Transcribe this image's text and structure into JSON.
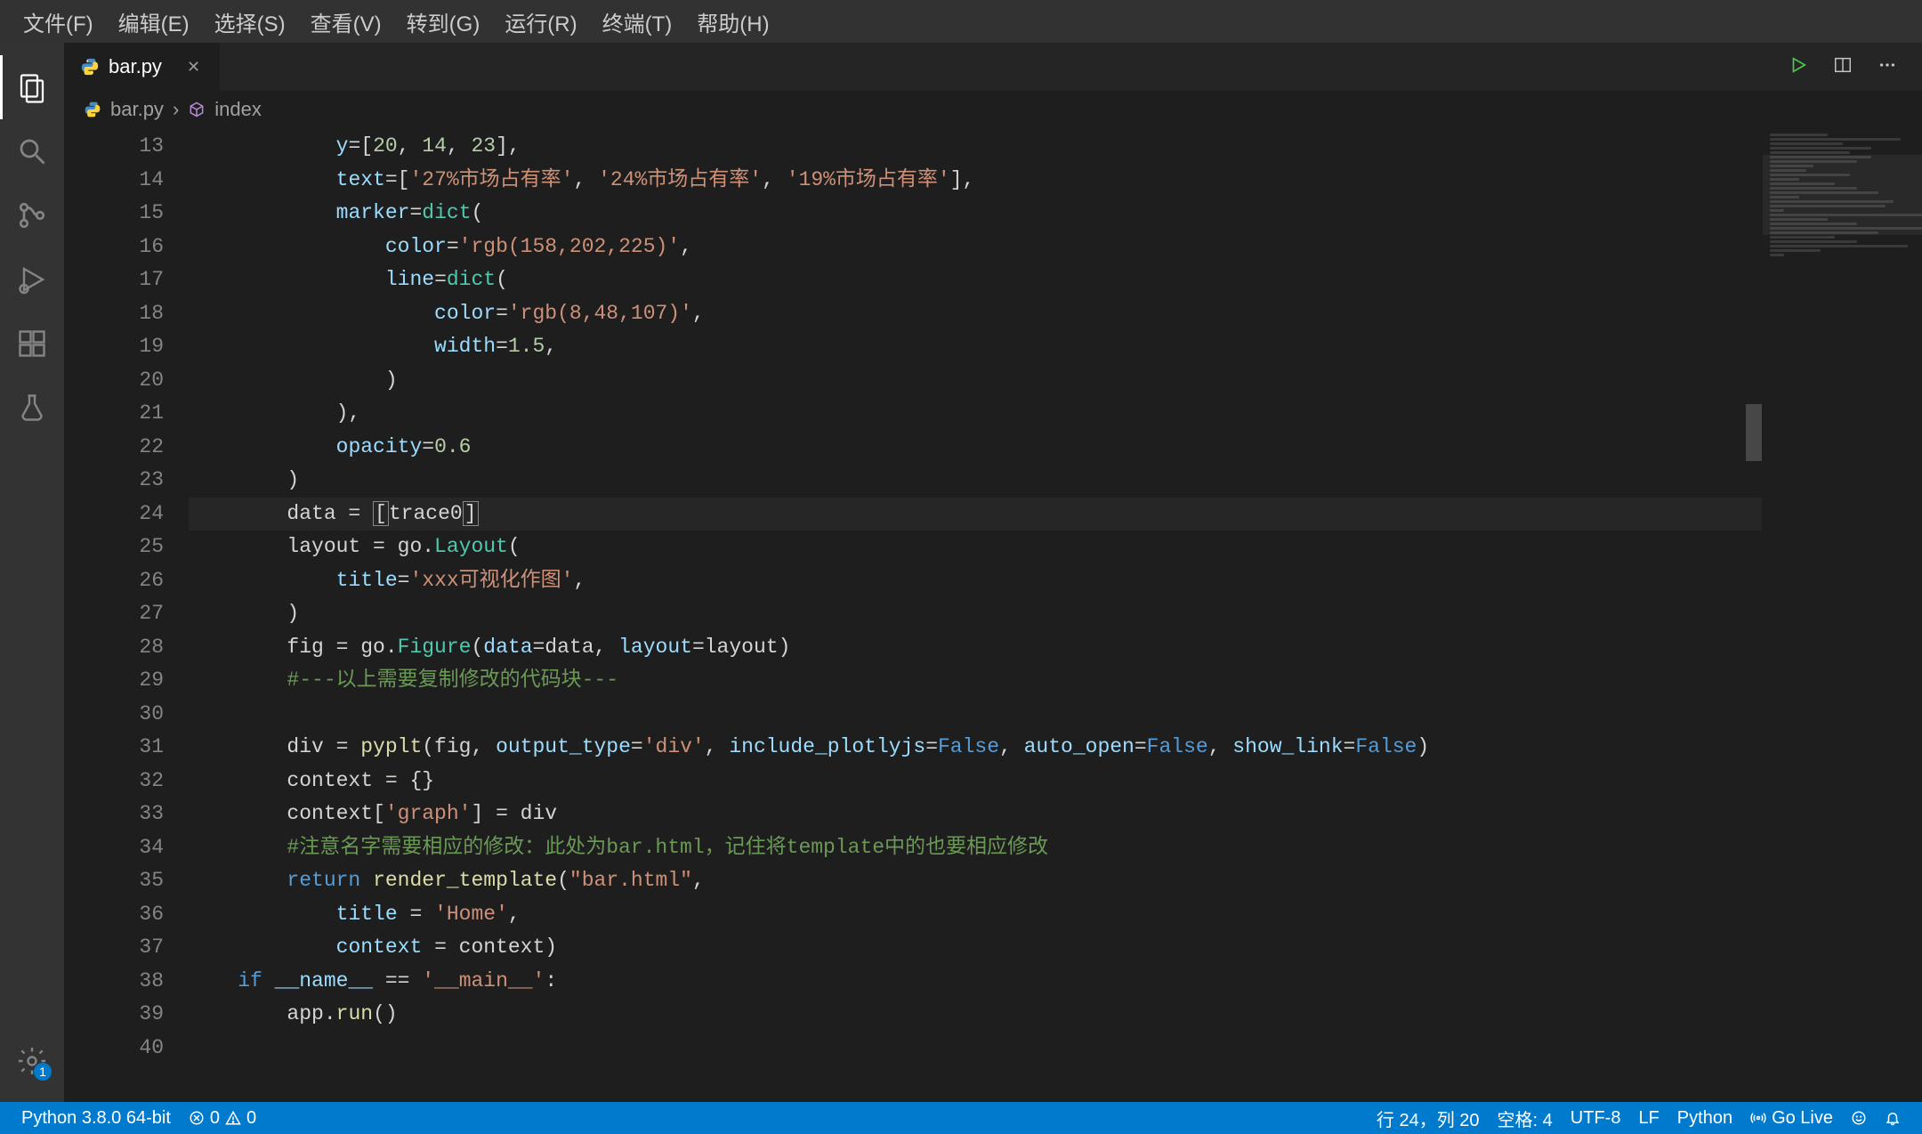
{
  "menubar": {
    "items": [
      "文件(F)",
      "编辑(E)",
      "选择(S)",
      "查看(V)",
      "转到(G)",
      "运行(R)",
      "终端(T)",
      "帮助(H)"
    ]
  },
  "activitybar": {
    "badge": "1"
  },
  "tab": {
    "filename": "bar.py"
  },
  "breadcrumbs": {
    "file": "bar.py",
    "symbol": "index"
  },
  "editor": {
    "first_line_no": 13,
    "lines": [
      {
        "n": 13,
        "tokens": [
          [
            "            ",
            "pun"
          ],
          [
            "y",
            "var"
          ],
          [
            "=[",
            "pun"
          ],
          [
            "20",
            "num"
          ],
          [
            ", ",
            "pun"
          ],
          [
            "14",
            "num"
          ],
          [
            ", ",
            "pun"
          ],
          [
            "23",
            "num"
          ],
          [
            "],",
            "pun"
          ]
        ]
      },
      {
        "n": 14,
        "tokens": [
          [
            "            ",
            "pun"
          ],
          [
            "text",
            "var"
          ],
          [
            "=[",
            "pun"
          ],
          [
            "'27%市场占有率'",
            "str"
          ],
          [
            ", ",
            "pun"
          ],
          [
            "'24%市场占有率'",
            "str"
          ],
          [
            ", ",
            "pun"
          ],
          [
            "'19%市场占有率'",
            "str"
          ],
          [
            "],",
            "pun"
          ]
        ]
      },
      {
        "n": 15,
        "tokens": [
          [
            "            ",
            "pun"
          ],
          [
            "marker",
            "var"
          ],
          [
            "=",
            "pun"
          ],
          [
            "dict",
            "type"
          ],
          [
            "(",
            "pun"
          ]
        ]
      },
      {
        "n": 16,
        "tokens": [
          [
            "                ",
            "pun"
          ],
          [
            "color",
            "var"
          ],
          [
            "=",
            "pun"
          ],
          [
            "'rgb(158,202,225)'",
            "str"
          ],
          [
            ",",
            "pun"
          ]
        ]
      },
      {
        "n": 17,
        "tokens": [
          [
            "                ",
            "pun"
          ],
          [
            "line",
            "var"
          ],
          [
            "=",
            "pun"
          ],
          [
            "dict",
            "type"
          ],
          [
            "(",
            "pun"
          ]
        ]
      },
      {
        "n": 18,
        "tokens": [
          [
            "                    ",
            "pun"
          ],
          [
            "color",
            "var"
          ],
          [
            "=",
            "pun"
          ],
          [
            "'rgb(8,48,107)'",
            "str"
          ],
          [
            ",",
            "pun"
          ]
        ]
      },
      {
        "n": 19,
        "tokens": [
          [
            "                    ",
            "pun"
          ],
          [
            "width",
            "var"
          ],
          [
            "=",
            "pun"
          ],
          [
            "1.5",
            "num"
          ],
          [
            ",",
            "pun"
          ]
        ]
      },
      {
        "n": 20,
        "tokens": [
          [
            "                )",
            "pun"
          ]
        ]
      },
      {
        "n": 21,
        "tokens": [
          [
            "            ),",
            "pun"
          ]
        ]
      },
      {
        "n": 22,
        "tokens": [
          [
            "            ",
            "pun"
          ],
          [
            "opacity",
            "var"
          ],
          [
            "=",
            "pun"
          ],
          [
            "0.6",
            "num"
          ]
        ]
      },
      {
        "n": 23,
        "tokens": [
          [
            "        )",
            "pun"
          ]
        ]
      },
      {
        "n": 24,
        "hl": true,
        "tokens": [
          [
            "        data = ",
            "pun"
          ],
          [
            "[",
            "cursor-open"
          ],
          [
            "trace0",
            "pun"
          ],
          [
            "]",
            "cursor-close"
          ]
        ]
      },
      {
        "n": 25,
        "tokens": [
          [
            "        layout = go.",
            "pun"
          ],
          [
            "Layout",
            "type"
          ],
          [
            "(",
            "pun"
          ]
        ]
      },
      {
        "n": 26,
        "tokens": [
          [
            "            ",
            "pun"
          ],
          [
            "title",
            "var"
          ],
          [
            "=",
            "pun"
          ],
          [
            "'xxx可视化作图'",
            "str"
          ],
          [
            ",",
            "pun"
          ]
        ]
      },
      {
        "n": 27,
        "tokens": [
          [
            "        )",
            "pun"
          ]
        ]
      },
      {
        "n": 28,
        "tokens": [
          [
            "        fig = go.",
            "pun"
          ],
          [
            "Figure",
            "type"
          ],
          [
            "(",
            "pun"
          ],
          [
            "data",
            "var"
          ],
          [
            "=data, ",
            "pun"
          ],
          [
            "layout",
            "var"
          ],
          [
            "=layout)",
            "pun"
          ]
        ]
      },
      {
        "n": 29,
        "tokens": [
          [
            "        ",
            "pun"
          ],
          [
            "#---以上需要复制修改的代码块---",
            "cmt"
          ]
        ]
      },
      {
        "n": 30,
        "tokens": [
          [
            "",
            "pun"
          ]
        ]
      },
      {
        "n": 31,
        "tokens": [
          [
            "        div = ",
            "pun"
          ],
          [
            "pyplt",
            "func"
          ],
          [
            "(fig, ",
            "pun"
          ],
          [
            "output_type",
            "var"
          ],
          [
            "=",
            "pun"
          ],
          [
            "'div'",
            "str"
          ],
          [
            ", ",
            "pun"
          ],
          [
            "include_plotlyjs",
            "var"
          ],
          [
            "=",
            "pun"
          ],
          [
            "False",
            "const"
          ],
          [
            ", ",
            "pun"
          ],
          [
            "auto_open",
            "var"
          ],
          [
            "=",
            "pun"
          ],
          [
            "False",
            "const"
          ],
          [
            ", ",
            "pun"
          ],
          [
            "show_link",
            "var"
          ],
          [
            "=",
            "pun"
          ],
          [
            "False",
            "const"
          ],
          [
            ")",
            "pun"
          ]
        ]
      },
      {
        "n": 32,
        "tokens": [
          [
            "        context = {}",
            "pun"
          ]
        ]
      },
      {
        "n": 33,
        "tokens": [
          [
            "        context[",
            "pun"
          ],
          [
            "'graph'",
            "str"
          ],
          [
            "] = div",
            "pun"
          ]
        ]
      },
      {
        "n": 34,
        "tokens": [
          [
            "        ",
            "pun"
          ],
          [
            "#注意名字需要相应的修改：此处为bar.html，记住将template中的也要相应修改",
            "cmt"
          ]
        ]
      },
      {
        "n": 35,
        "tokens": [
          [
            "        ",
            "pun"
          ],
          [
            "return",
            "kw"
          ],
          [
            " ",
            "pun"
          ],
          [
            "render_template",
            "func"
          ],
          [
            "(",
            "pun"
          ],
          [
            "\"bar.html\"",
            "str"
          ],
          [
            ",",
            "pun"
          ]
        ]
      },
      {
        "n": 36,
        "tokens": [
          [
            "            ",
            "pun"
          ],
          [
            "title",
            "var"
          ],
          [
            " = ",
            "pun"
          ],
          [
            "'Home'",
            "str"
          ],
          [
            ",",
            "pun"
          ]
        ]
      },
      {
        "n": 37,
        "tokens": [
          [
            "            ",
            "pun"
          ],
          [
            "context",
            "var"
          ],
          [
            " = context)",
            "pun"
          ]
        ]
      },
      {
        "n": 38,
        "tokens": [
          [
            "    ",
            "pun"
          ],
          [
            "if",
            "kw"
          ],
          [
            " ",
            "pun"
          ],
          [
            "__name__",
            "var"
          ],
          [
            " == ",
            "pun"
          ],
          [
            "'__main__'",
            "str"
          ],
          [
            ":",
            "pun"
          ]
        ]
      },
      {
        "n": 39,
        "tokens": [
          [
            "        app.",
            "pun"
          ],
          [
            "run",
            "func"
          ],
          [
            "()",
            "pun"
          ]
        ]
      },
      {
        "n": 40,
        "tokens": [
          [
            "",
            "pun"
          ]
        ]
      }
    ]
  },
  "statusbar": {
    "python_env": "Python 3.8.0 64-bit",
    "errors": "0",
    "warnings": "0",
    "cursor": "行 24，列 20",
    "spaces": "空格: 4",
    "encoding": "UTF-8",
    "eol": "LF",
    "language": "Python",
    "golive": "Go Live"
  }
}
